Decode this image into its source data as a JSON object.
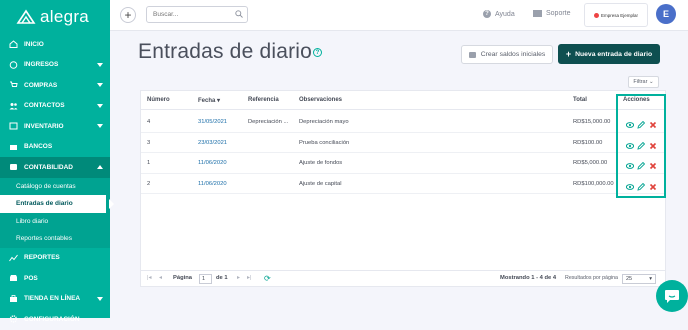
{
  "brand": {
    "name": "alegra",
    "accent": "#00b19d",
    "dark": "#0e4f50"
  },
  "sidebar": {
    "items": [
      {
        "label": "INICIO",
        "icon": "home-icon"
      },
      {
        "label": "INGRESOS",
        "icon": "income-icon",
        "chevron": "down"
      },
      {
        "label": "COMPRAS",
        "icon": "cart-icon",
        "chevron": "down"
      },
      {
        "label": "CONTACTOS",
        "icon": "contacts-icon",
        "chevron": "down"
      },
      {
        "label": "INVENTARIO",
        "icon": "inventory-icon",
        "chevron": "down"
      },
      {
        "label": "BANCOS",
        "icon": "bank-icon"
      },
      {
        "label": "CONTABILIDAD",
        "icon": "accounting-icon",
        "chevron": "up"
      }
    ],
    "sub_items": [
      "Catálogo de cuentas",
      "Entradas de diario",
      "Libro diario",
      "Reportes contables"
    ],
    "bottom_items": [
      {
        "label": "REPORTES",
        "icon": "reports-icon"
      },
      {
        "label": "POS",
        "icon": "pos-icon"
      },
      {
        "label": "TIENDA EN LÍNEA",
        "icon": "store-icon",
        "chevron": "down"
      },
      {
        "label": "CONFIGURACIÓN",
        "icon": "gear-icon"
      }
    ]
  },
  "topbar": {
    "search_placeholder": "Buscar...",
    "help": "Ayuda",
    "support": "Soporte",
    "company": "Empresa Ejemplar",
    "avatar": "E"
  },
  "page": {
    "title": "Entradas de diario",
    "btn_secondary": "Crear saldos iniciales",
    "btn_primary": "Nueva entrada de diario",
    "filter": "Filtrar"
  },
  "table": {
    "headers": [
      "Número",
      "Fecha",
      "Referencia",
      "Observaciones",
      "Total",
      "Acciones"
    ],
    "rows": [
      {
        "numero": "4",
        "fecha": "31/05/2021",
        "referencia": "Depreciación ...",
        "observaciones": "Depreciación mayo",
        "total": "RD$15,000.00"
      },
      {
        "numero": "3",
        "fecha": "23/03/2021",
        "referencia": "",
        "observaciones": "Prueba conciliación",
        "total": "RD$100.00"
      },
      {
        "numero": "1",
        "fecha": "11/06/2020",
        "referencia": "",
        "observaciones": "Ajuste de fondos",
        "total": "RD$5,000.00"
      },
      {
        "numero": "2",
        "fecha": "11/06/2020",
        "referencia": "",
        "observaciones": "Ajuste de capital",
        "total": "RD$100,000.00"
      }
    ]
  },
  "pager": {
    "page_label": "Página",
    "page_value": "1",
    "of_label": "de 1",
    "showing": "Mostrando 1 - 4 de 4",
    "per_page_label": "Resultados por página",
    "per_page_value": "25"
  }
}
